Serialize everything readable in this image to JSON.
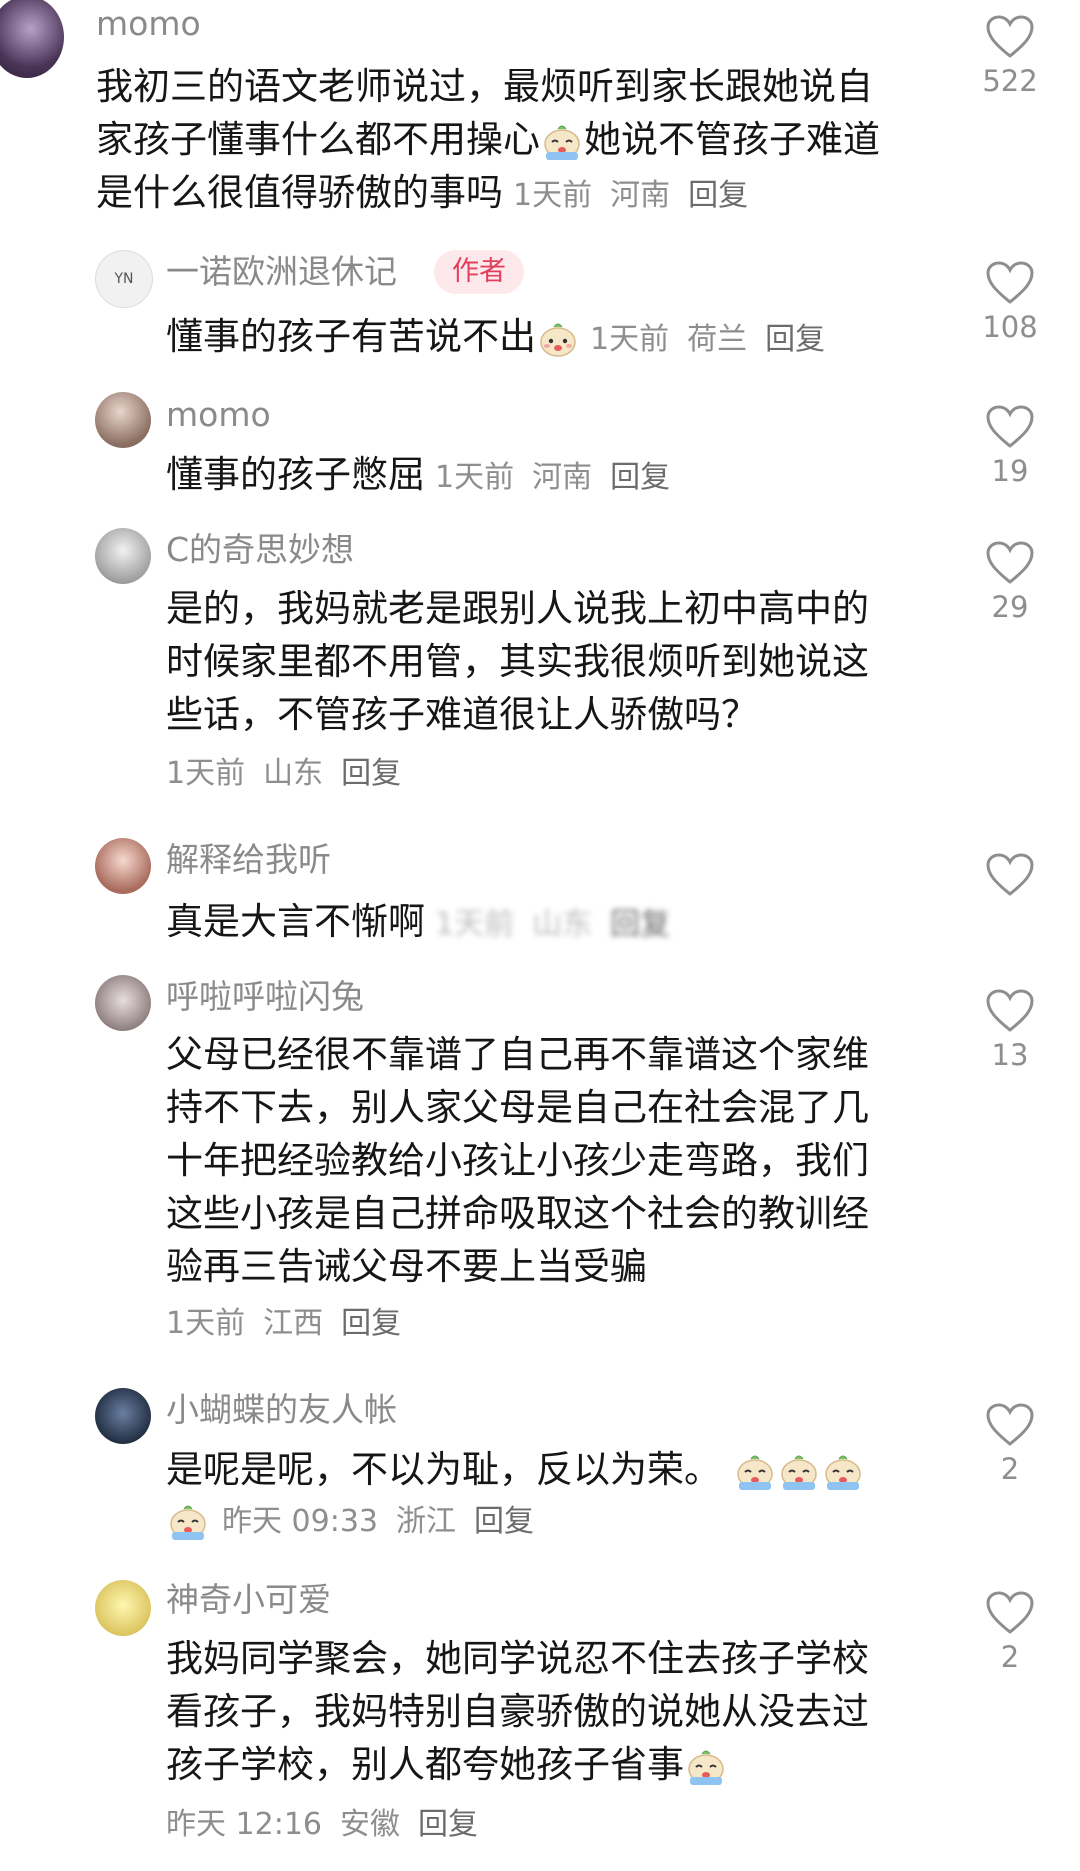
{
  "comments": [
    {
      "name": "momo",
      "lines": [
        "我初三的语文老师说过，最烦听到家长跟她说自",
        "家孩子懂事什么都不用操心",
        "是什么很值得骄傲的事吗"
      ],
      "line2_after_emoji": "她说不管孩子难道",
      "time": "1天前",
      "location": "河南",
      "reply": "回复",
      "likes": "522",
      "emoji": "crying-bun-emoji"
    },
    {
      "name": "一诺欧洲退休记",
      "badge": "作者",
      "lines": [
        "懂事的孩子有苦说不出"
      ],
      "time": "1天前",
      "location": "荷兰",
      "reply": "回复",
      "likes": "108",
      "emoji": "sad-bun-emoji"
    },
    {
      "name": "momo",
      "lines": [
        "懂事的孩子憋屈"
      ],
      "time": "1天前",
      "location": "河南",
      "reply": "回复",
      "likes": "19"
    },
    {
      "name": "C的奇思妙想",
      "lines": [
        "是的，我妈就老是跟别人说我上初中高中的",
        "时候家里都不用管，其实我很烦听到她说这",
        "些话，不管孩子难道很让人骄傲吗？"
      ],
      "time": "1天前",
      "location": "山东",
      "reply": "回复",
      "likes": "29"
    },
    {
      "name": "解释给我听",
      "lines": [
        "真是大言不惭啊"
      ],
      "time": "1天前",
      "location": "山东",
      "reply": "回复",
      "likes": ""
    },
    {
      "name": "呼啦呼啦闪兔",
      "lines": [
        "父母已经很不靠谱了自己再不靠谱这个家维",
        "持不下去，别人家父母是自己在社会混了几",
        "十年把经验教给小孩让小孩少走弯路，我们",
        "这些小孩是自己拼命吸取这个社会的教训经",
        "验再三告诫父母不要上当受骗"
      ],
      "time": "1天前",
      "location": "江西",
      "reply": "回复",
      "likes": "13"
    },
    {
      "name": "小蝴蝶的友人帐",
      "lines": [
        "是呢是呢，不以为耻，反以为荣。"
      ],
      "time": "昨天 09:33",
      "location": "浙江",
      "reply": "回复",
      "likes": "2",
      "emoji": "crying-bun-emoji"
    },
    {
      "name": "神奇小可爱",
      "lines": [
        "我妈同学聚会，她同学说忍不住去孩子学校",
        "看孩子，我妈特别自豪骄傲的说她从没去过",
        "孩子学校，别人都夸她孩子省事"
      ],
      "time": "昨天 12:16",
      "location": "安徽",
      "reply": "回复",
      "likes": "2",
      "emoji": "scream-bun-emoji"
    }
  ],
  "colors": {
    "text": "#161616",
    "meta": "#8e8e8e",
    "author_badge_bg": "#fde8ec",
    "author_badge_text": "#e0405d"
  }
}
